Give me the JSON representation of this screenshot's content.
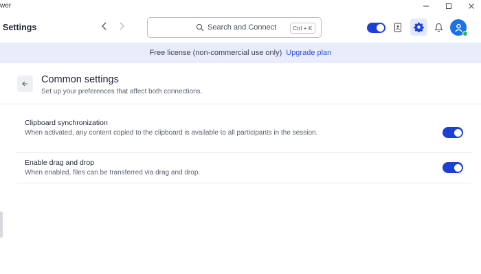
{
  "window": {
    "title_fragment": "wer"
  },
  "header": {
    "title": "Settings",
    "search": {
      "placeholder": "Search and Connect",
      "shortcut": "Ctrl + K"
    }
  },
  "banner": {
    "text": "Free license (non-commercial use only)",
    "link": "Upgrade plan"
  },
  "section": {
    "title": "Common settings",
    "subtitle": "Set up your preferences that affect both connections."
  },
  "settings": [
    {
      "title": "Clipboard synchronization",
      "description": "When activated, any content copied to the clipboard is available to all participants in the session.",
      "enabled": true
    },
    {
      "title": "Enable drag and drop",
      "description": "When enabled, files can be transferred via drag and drop.",
      "enabled": true
    }
  ],
  "colors": {
    "accent": "#1d3fd6",
    "banner_bg": "#e9edfb",
    "link": "#2b4fd9",
    "online": "#2eb84b"
  },
  "icons": [
    "minimize-icon",
    "maximize-icon",
    "close-icon",
    "chevron-left-icon",
    "chevron-right-icon",
    "search-icon",
    "contacts-icon",
    "gear-icon",
    "bell-icon",
    "user-icon",
    "arrow-left-icon"
  ]
}
